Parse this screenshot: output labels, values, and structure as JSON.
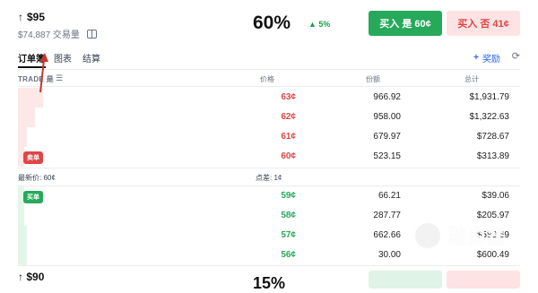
{
  "header": {
    "arrow": "↑",
    "price": "$95",
    "volume": "$74,887 交易量",
    "probability": "60%",
    "change": "5%",
    "buy_yes_label": "买入 是 60¢",
    "buy_no_label": "买入 否 41¢"
  },
  "tabs": {
    "items": [
      {
        "label": "订单簿"
      },
      {
        "label": "图表"
      },
      {
        "label": "结算"
      }
    ],
    "reward_label": "奖励"
  },
  "table": {
    "headers": {
      "trade": "TRADE 是",
      "price": "价格",
      "shares": "份额",
      "total": "总计"
    },
    "asks": [
      {
        "price": "63¢",
        "shares": "966.92",
        "total": "$1,931.79",
        "depth": 0.05
      },
      {
        "price": "62¢",
        "shares": "958.00",
        "total": "$1,322.63",
        "depth": 0.034
      },
      {
        "price": "61¢",
        "shares": "679.97",
        "total": "$728.67",
        "depth": 0.018
      },
      {
        "price": "60¢",
        "shares": "523.15",
        "total": "$313.89",
        "depth": 0.012
      }
    ],
    "ask_badge": "卖单",
    "bid_badge": "买单",
    "last_price": "最新价: 60¢",
    "spread": "点差: 1¢",
    "bids": [
      {
        "price": "59¢",
        "shares": "66.21",
        "total": "$39.06",
        "depth": 0.012
      },
      {
        "price": "58¢",
        "shares": "287.77",
        "total": "$205.97",
        "depth": 0.012
      },
      {
        "price": "57¢",
        "shares": "662.66",
        "total": "$583.69",
        "depth": 0.018
      },
      {
        "price": "56¢",
        "shares": "30.00",
        "total": "$600.49",
        "depth": 0.018
      }
    ]
  },
  "next_market": {
    "price": "$90",
    "probability": "15%"
  },
  "watermark": "路由器",
  "colors": {
    "accent_green": "#26a95a",
    "accent_red": "#e04545",
    "link_blue": "#2563eb"
  }
}
